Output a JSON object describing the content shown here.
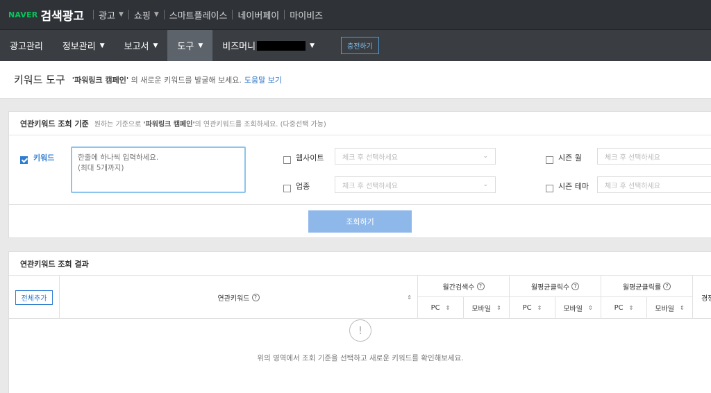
{
  "brand": {
    "naver": "NAVER",
    "title": "검색광고"
  },
  "topnav": [
    {
      "label": "광고",
      "chevron": true
    },
    {
      "label": "쇼핑",
      "chevron": true
    },
    {
      "label": "스마트플레이스",
      "chevron": false
    },
    {
      "label": "네이버페이",
      "chevron": false
    },
    {
      "label": "마이비즈",
      "chevron": false
    }
  ],
  "navbar": {
    "items": [
      {
        "label": "광고관리"
      },
      {
        "label": "정보관리"
      },
      {
        "label": "보고서"
      },
      {
        "label": "도구"
      },
      {
        "label": "비즈머니"
      }
    ],
    "charge_label": "충전하기"
  },
  "toolhead": {
    "title": "키워드 도구",
    "campaign": "'파워링크 캠페인'",
    "desc_suffix": " 의 새로운 키워드를 발굴해 보세요.",
    "help": "도움말 보기"
  },
  "criteria": {
    "title": "연관키워드 조회 기준",
    "desc_prefix": "원하는 기준으로 ",
    "campaign": "'파워링크 캠페인'",
    "desc_suffix": "의 연관키워드를 조회하세요. (다중선택 가능)",
    "keyword_label": "키워드",
    "keyword_placeholder": "한줄에 하나씩 입력하세요.\n(최대 5개까지)",
    "website_label": "웹사이트",
    "industry_label": "업종",
    "season_month_label": "시즌 월",
    "season_theme_label": "시즌 테마",
    "select_placeholder": "체크 후 선택하세요",
    "query_button": "조회하기"
  },
  "results": {
    "title": "연관키워드 조회 결과",
    "add_all": "전체추가",
    "columns": {
      "keyword": "연관키워드",
      "monthly_search": "월간검색수",
      "avg_clicks": "월평균클릭수",
      "avg_ctr": "월평균클릭률",
      "competition": "경쟁"
    },
    "sub": {
      "pc": "PC",
      "mobile": "모바일"
    },
    "empty_icon": "!",
    "empty_message": "위의 영역에서 조회 기준을 선택하고 새로운 키워드를 확인해보세요."
  }
}
